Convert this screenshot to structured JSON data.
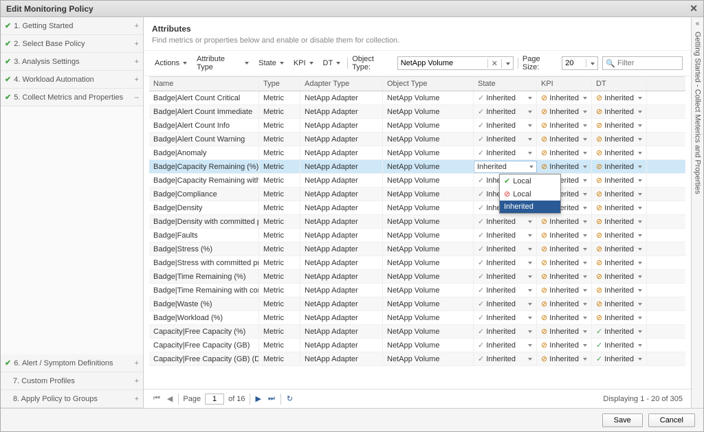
{
  "title": "Edit Monitoring Policy",
  "sidebar_top": [
    {
      "check": true,
      "label": "1. Getting Started",
      "exp": "+"
    },
    {
      "check": true,
      "label": "2. Select Base Policy",
      "exp": "+"
    },
    {
      "check": true,
      "label": "3. Analysis Settings",
      "exp": "+"
    },
    {
      "check": true,
      "label": "4. Workload Automation",
      "exp": "+"
    },
    {
      "check": true,
      "label": "5. Collect Metrics and Properties",
      "exp": "–"
    }
  ],
  "sidebar_bottom": [
    {
      "check": true,
      "label": "6. Alert / Symptom Definitions",
      "exp": "+"
    },
    {
      "check": false,
      "label": "7. Custom Profiles",
      "exp": "+"
    },
    {
      "check": false,
      "label": "8. Apply Policy to Groups",
      "exp": "+"
    }
  ],
  "section": {
    "title": "Attributes",
    "subtitle": "Find metrics or properties below and enable or disable them for collection."
  },
  "toolbar": {
    "actions": "Actions",
    "attr_type": "Attribute Type",
    "state": "State",
    "kpi": "KPI",
    "dt": "DT",
    "obj_type_label": "Object Type:",
    "obj_type_value": "NetApp Volume",
    "page_size_label": "Page Size:",
    "page_size_value": "20",
    "filter_placeholder": "Filter"
  },
  "columns": {
    "name": "Name",
    "type": "Type",
    "adapter": "Adapter Type",
    "object": "Object Type",
    "state": "State",
    "kpi": "KPI",
    "dt": "DT"
  },
  "rows": [
    {
      "name": "Badge|Alert Count Critical",
      "type": "Metric",
      "adapter": "NetApp Adapter",
      "object": "NetApp Volume",
      "state": "Inherited",
      "kpi": "Inherited",
      "dt": "Inherited",
      "si": "g",
      "ki": "n",
      "di": "n"
    },
    {
      "name": "Badge|Alert Count Immediate",
      "type": "Metric",
      "adapter": "NetApp Adapter",
      "object": "NetApp Volume",
      "state": "Inherited",
      "kpi": "Inherited",
      "dt": "Inherited",
      "si": "g",
      "ki": "n",
      "di": "n"
    },
    {
      "name": "Badge|Alert Count Info",
      "type": "Metric",
      "adapter": "NetApp Adapter",
      "object": "NetApp Volume",
      "state": "Inherited",
      "kpi": "Inherited",
      "dt": "Inherited",
      "si": "g",
      "ki": "n",
      "di": "n"
    },
    {
      "name": "Badge|Alert Count Warning",
      "type": "Metric",
      "adapter": "NetApp Adapter",
      "object": "NetApp Volume",
      "state": "Inherited",
      "kpi": "Inherited",
      "dt": "Inherited",
      "si": "g",
      "ki": "n",
      "di": "n"
    },
    {
      "name": "Badge|Anomaly",
      "type": "Metric",
      "adapter": "NetApp Adapter",
      "object": "NetApp Volume",
      "state": "Inherited",
      "kpi": "Inherited",
      "dt": "Inherited",
      "si": "g",
      "ki": "n",
      "di": "n"
    },
    {
      "name": "Badge|Capacity Remaining (%)",
      "type": "Metric",
      "adapter": "NetApp Adapter",
      "object": "NetApp Volume",
      "state": "Inherited",
      "kpi": "Inherited",
      "dt": "Inherited",
      "sel": true,
      "si": "",
      "ki": "n",
      "di": "n"
    },
    {
      "name": "Badge|Capacity Remaining with ...",
      "type": "Metric",
      "adapter": "NetApp Adapter",
      "object": "NetApp Volume",
      "state": "Inherited",
      "kpi": "Inherited",
      "dt": "Inherited",
      "si": "g",
      "ki": "n",
      "di": "n"
    },
    {
      "name": "Badge|Compliance",
      "type": "Metric",
      "adapter": "NetApp Adapter",
      "object": "NetApp Volume",
      "state": "Inherited",
      "kpi": "Inherited",
      "dt": "Inherited",
      "si": "g",
      "ki": "n",
      "di": "n"
    },
    {
      "name": "Badge|Density",
      "type": "Metric",
      "adapter": "NetApp Adapter",
      "object": "NetApp Volume",
      "state": "Inherited",
      "kpi": "Inherited",
      "dt": "Inherited",
      "si": "g",
      "ki": "n",
      "di": "n"
    },
    {
      "name": "Badge|Density with committed pr...",
      "type": "Metric",
      "adapter": "NetApp Adapter",
      "object": "NetApp Volume",
      "state": "Inherited",
      "kpi": "Inherited",
      "dt": "Inherited",
      "si": "g",
      "ki": "n",
      "di": "n"
    },
    {
      "name": "Badge|Faults",
      "type": "Metric",
      "adapter": "NetApp Adapter",
      "object": "NetApp Volume",
      "state": "Inherited",
      "kpi": "Inherited",
      "dt": "Inherited",
      "si": "g",
      "ki": "n",
      "di": "n"
    },
    {
      "name": "Badge|Stress (%)",
      "type": "Metric",
      "adapter": "NetApp Adapter",
      "object": "NetApp Volume",
      "state": "Inherited",
      "kpi": "Inherited",
      "dt": "Inherited",
      "si": "g",
      "ki": "n",
      "di": "n"
    },
    {
      "name": "Badge|Stress with committed proj...",
      "type": "Metric",
      "adapter": "NetApp Adapter",
      "object": "NetApp Volume",
      "state": "Inherited",
      "kpi": "Inherited",
      "dt": "Inherited",
      "si": "g",
      "ki": "n",
      "di": "n"
    },
    {
      "name": "Badge|Time Remaining (%)",
      "type": "Metric",
      "adapter": "NetApp Adapter",
      "object": "NetApp Volume",
      "state": "Inherited",
      "kpi": "Inherited",
      "dt": "Inherited",
      "si": "g",
      "ki": "n",
      "di": "n"
    },
    {
      "name": "Badge|Time Remaining with com...",
      "type": "Metric",
      "adapter": "NetApp Adapter",
      "object": "NetApp Volume",
      "state": "Inherited",
      "kpi": "Inherited",
      "dt": "Inherited",
      "si": "g",
      "ki": "n",
      "di": "n"
    },
    {
      "name": "Badge|Waste (%)",
      "type": "Metric",
      "adapter": "NetApp Adapter",
      "object": "NetApp Volume",
      "state": "Inherited",
      "kpi": "Inherited",
      "dt": "Inherited",
      "si": "g",
      "ki": "n",
      "di": "n"
    },
    {
      "name": "Badge|Workload (%)",
      "type": "Metric",
      "adapter": "NetApp Adapter",
      "object": "NetApp Volume",
      "state": "Inherited",
      "kpi": "Inherited",
      "dt": "Inherited",
      "si": "g",
      "ki": "n",
      "di": "n"
    },
    {
      "name": "Capacity|Free Capacity (%)",
      "type": "Metric",
      "adapter": "NetApp Adapter",
      "object": "NetApp Volume",
      "state": "Inherited",
      "kpi": "Inherited",
      "dt": "Inherited",
      "si": "g",
      "ki": "n",
      "di": "t"
    },
    {
      "name": "Capacity|Free Capacity (GB)",
      "type": "Metric",
      "adapter": "NetApp Adapter",
      "object": "NetApp Volume",
      "state": "Inherited",
      "kpi": "Inherited",
      "dt": "Inherited",
      "si": "g",
      "ki": "n",
      "di": "t"
    },
    {
      "name": "Capacity|Free Capacity (GB) (De...",
      "type": "Metric",
      "adapter": "NetApp Adapter",
      "object": "NetApp Volume",
      "state": "Inherited",
      "kpi": "Inherited",
      "dt": "Inherited",
      "si": "g",
      "ki": "n",
      "di": "t"
    }
  ],
  "dropdown": {
    "opt1": "Local",
    "opt2": "Local",
    "opt3": "Inherited"
  },
  "pager": {
    "page_label": "Page",
    "page": "1",
    "total": "of 16",
    "display": "Displaying 1 - 20 of 305"
  },
  "footer": {
    "save": "Save",
    "cancel": "Cancel"
  },
  "rightbar": "Getting Started - Collect Meterics and Properties"
}
